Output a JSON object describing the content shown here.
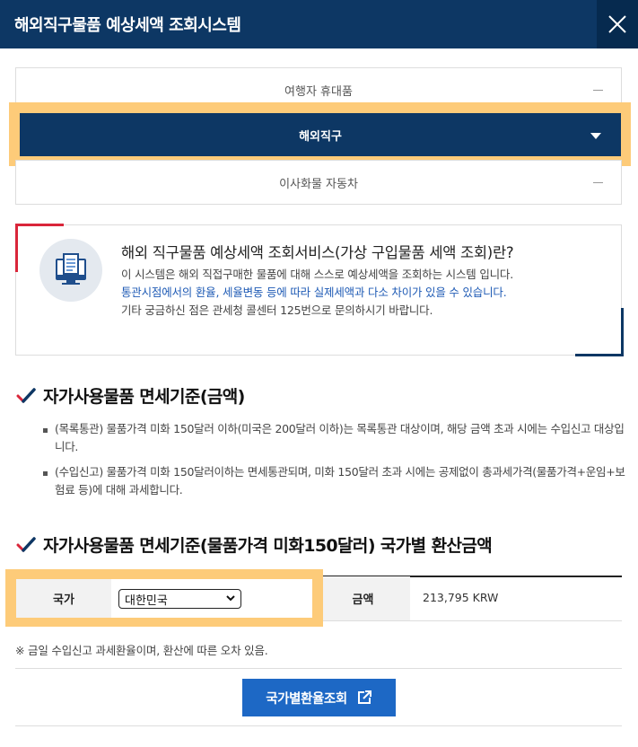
{
  "window": {
    "title": "해외직구물품 예상세액 조회시스템",
    "close_icon": "close-icon"
  },
  "accordion": {
    "items": [
      {
        "label": "여행자 휴대품",
        "state": "collapsed"
      },
      {
        "label": "해외직구",
        "state": "expanded"
      },
      {
        "label": "이사화물 자동차",
        "state": "collapsed"
      }
    ]
  },
  "info": {
    "title": "해외 직구물품 예상세액 조회서비스(가상 구입물품 세액 조회)란?",
    "line1": "이 시스템은 해외 직접구매한 물품에 대해 스스로 예상세액을 조회하는 시스템 입니다.",
    "line2": "통관시점에서의 환율, 세율변동 등에 따라 실제세액과 다소 차이가 있을 수 있습니다.",
    "line3": "기타 궁금하신 점은 관세청 콜센터 125번으로 문의하시기 바랍니다.",
    "icon": "monitor-document-icon"
  },
  "section1": {
    "title": "자가사용물품 면세기준(금액)",
    "bullets": [
      "(목록통관) 물품가격 미화 150달러 이하(미국은 200달러 이하)는 목록통관 대상이며, 해당 금액 초과 시에는 수입신고 대상입니다.",
      "(수입신고) 물품가격 미화 150달러이하는 면세통관되며, 미화 150달러 초과 시에는 공제없이 총과세가격(물품가격+운임+보험료 등)에 대해 과세합니다."
    ]
  },
  "section2": {
    "title": "자가사용물품 면세기준(물품가격 미화150달러) 국가별 환산금액",
    "country_label": "국가",
    "country_selected": "대한민국",
    "amount_label": "금액",
    "amount_value": "213,795 KRW",
    "note": "※ 금일 수입신고 과세환율이며, 환산에 따른 오차 있음.",
    "button_label": "국가별환율조회"
  },
  "colors": {
    "navy": "#0d3764",
    "highlight": "#fdcb79",
    "accent_red": "#d9263a",
    "button_blue": "#1d68c5",
    "link_blue": "#1f5bb5"
  }
}
